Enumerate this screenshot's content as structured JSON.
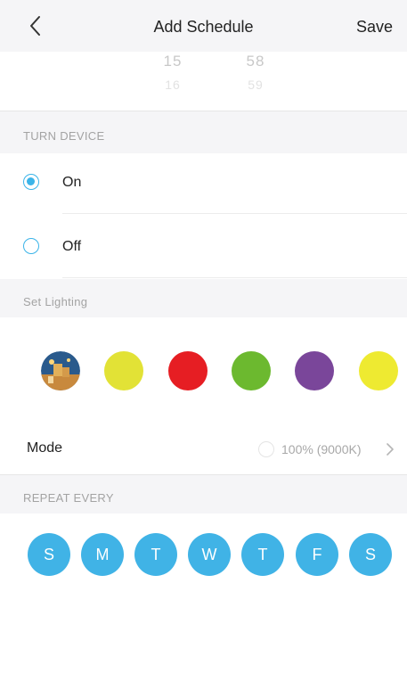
{
  "header": {
    "title": "Add Schedule",
    "save_label": "Save",
    "back_icon": "chevron-left-icon"
  },
  "time_picker": {
    "hours": [
      "15",
      "16"
    ],
    "minutes": [
      "58",
      "59"
    ]
  },
  "turn_device": {
    "section_label": "TURN DEVICE",
    "options": [
      {
        "label": "On",
        "selected": true
      },
      {
        "label": "Off",
        "selected": false
      }
    ],
    "accent_color": "#3bb4e8"
  },
  "lighting": {
    "section_label": "Set Lighting",
    "swatches": [
      {
        "type": "photo",
        "icon": "photo-scene-icon"
      },
      {
        "type": "color",
        "color": "#e2e236"
      },
      {
        "type": "color",
        "color": "#e61e23"
      },
      {
        "type": "color",
        "color": "#6cb92f"
      },
      {
        "type": "color",
        "color": "#7a469a"
      },
      {
        "type": "color",
        "color": "#eeea31"
      }
    ]
  },
  "mode": {
    "label": "Mode",
    "value": "100% (9000K)"
  },
  "repeat": {
    "section_label": "REPEAT EVERY",
    "days": [
      "S",
      "M",
      "T",
      "W",
      "T",
      "F",
      "S"
    ],
    "day_color": "#40b3e6"
  }
}
